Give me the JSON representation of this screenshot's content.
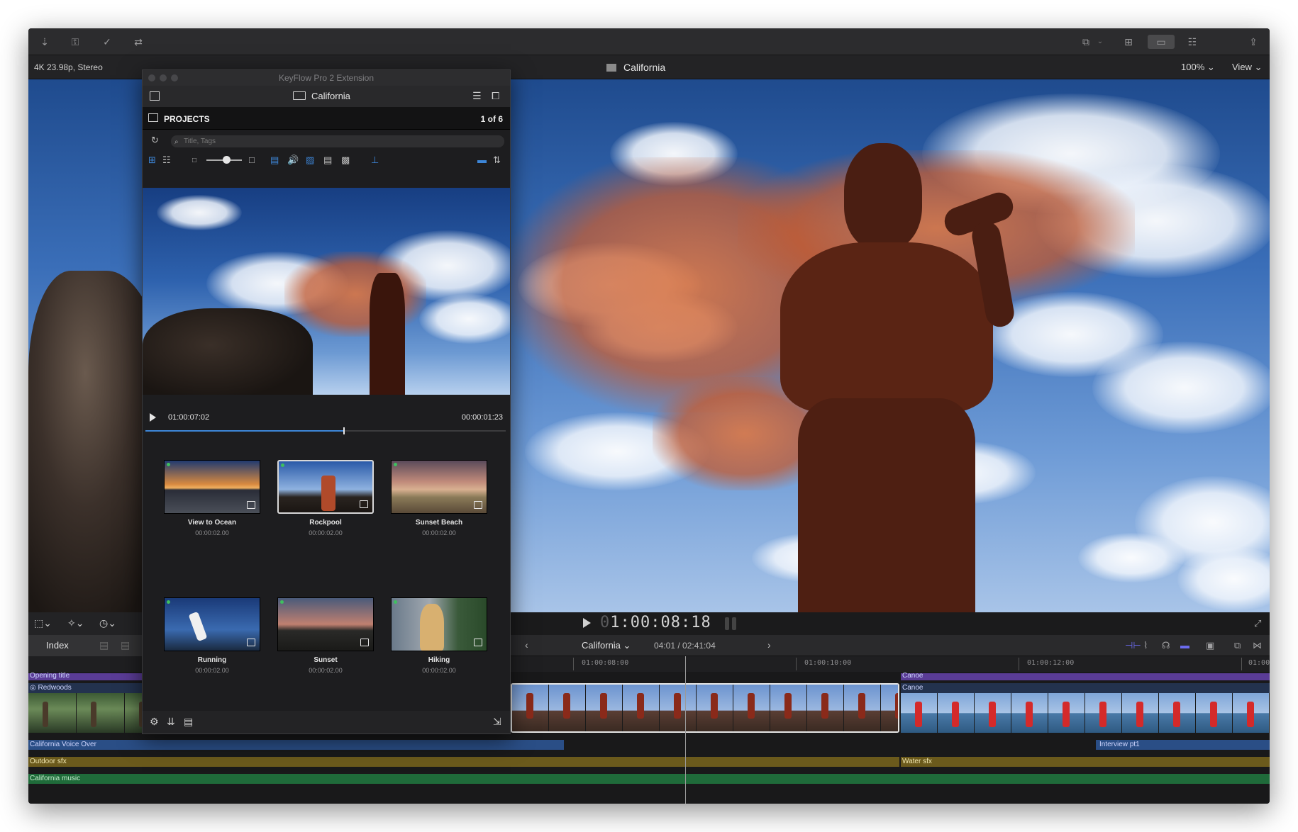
{
  "toolbar": {
    "left_icons": [
      "import-icon",
      "keyword-icon",
      "checkmark-icon",
      "share-icon"
    ],
    "right_icons": [
      "browser-toggle-icon",
      "grid-icon",
      "filmstrip-icon",
      "inspector-icon",
      "export-icon"
    ]
  },
  "viewer": {
    "format": "4K 23.98p, Stereo",
    "title": "California",
    "zoom": "100%",
    "view_menu": "View",
    "timecode_dim": "0",
    "timecode": "1:00:08:18"
  },
  "panel": {
    "window_title": "KeyFlow Pro 2 Extension",
    "library_name": "California",
    "section": "PROJECTS",
    "count": "1 of 6",
    "search_placeholder": "Title, Tags",
    "timecode_in": "01:00:07:02",
    "timecode_dur": "00:00:01:23",
    "scrub_progress": 0.55,
    "thumbnails": [
      {
        "name": "View to Ocean",
        "duration": "00:00:02.00",
        "selected": false
      },
      {
        "name": "Rockpool",
        "duration": "00:00:02.00",
        "selected": true
      },
      {
        "name": "Sunset Beach",
        "duration": "00:00:02.00",
        "selected": false
      },
      {
        "name": "Running",
        "duration": "00:00:02.00",
        "selected": false
      },
      {
        "name": "Sunset",
        "duration": "00:00:02.00",
        "selected": false
      },
      {
        "name": "Hiking",
        "duration": "00:00:02.00",
        "selected": false
      }
    ]
  },
  "timeline": {
    "index_label": "Index",
    "project_name": "California",
    "duration": "04:01 / 02:41:04",
    "ruler": [
      "01:00:08:00",
      "01:00:10:00",
      "01:00:12:00",
      "01:00"
    ],
    "clips": {
      "opening_title": "Opening title",
      "redwoods": "Redwoods",
      "canoe_top": "Canoe",
      "canoe": "Canoe",
      "voice_over": "California Voice Over",
      "interview": "Interview pt1",
      "outdoor_sfx": "Outdoor sfx",
      "water_sfx": "Water sfx",
      "music": "California music"
    }
  },
  "colors": {
    "accent_blue": "#3d86d8",
    "title_purple": "#5a3c96",
    "voice_blue": "#2a4e86",
    "sfx_gold": "#6b5a1c",
    "music_green": "#1f6b3a"
  }
}
